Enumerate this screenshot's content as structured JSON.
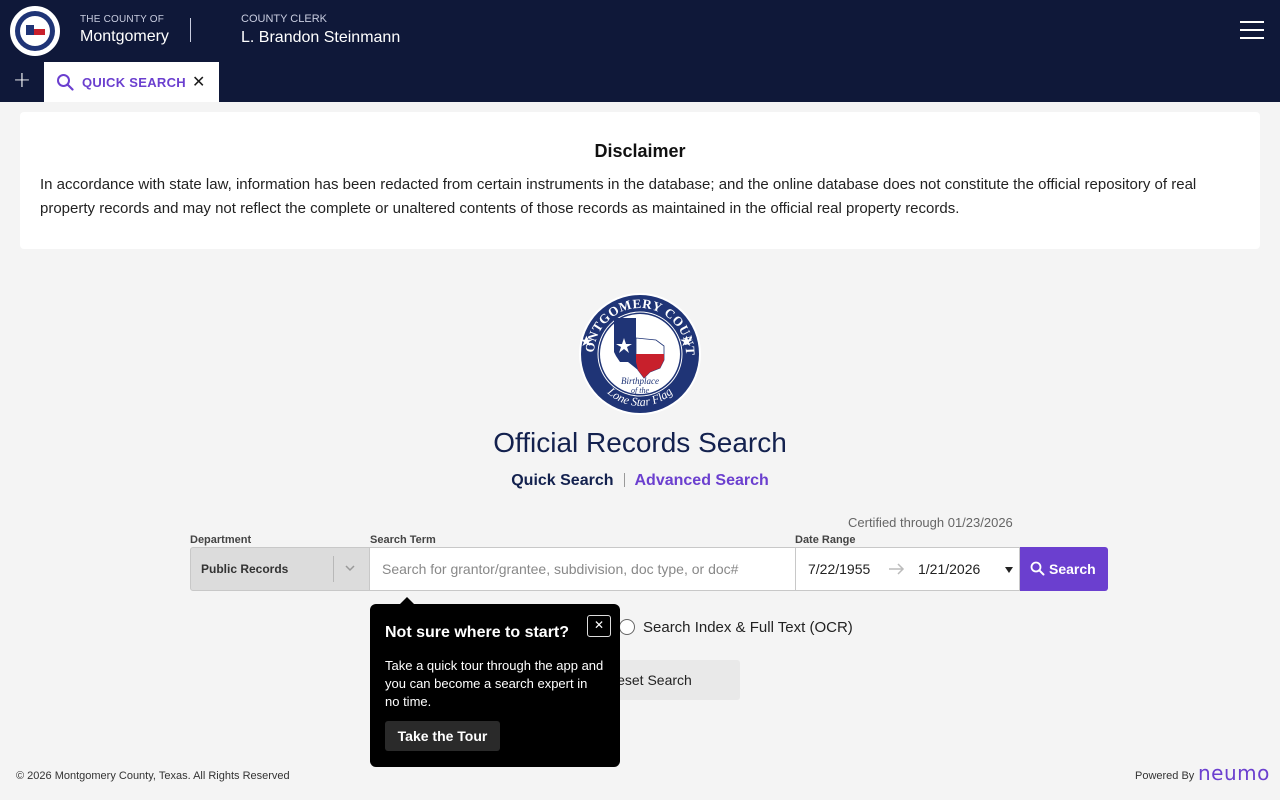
{
  "header": {
    "county_small": "THE COUNTY OF",
    "county_name": "Montgomery",
    "clerk_small": "COUNTY CLERK",
    "clerk_name": "L. Brandon Steinmann",
    "menu_icon": "hamburger-icon"
  },
  "tabs": {
    "add_icon": "plus-icon",
    "active": {
      "icon": "search-icon",
      "label": "QUICK SEARCH",
      "close_icon": "close-icon"
    }
  },
  "disclaimer": {
    "title": "Disclaimer",
    "text": "In accordance with state law, information has been redacted from certain instruments in the database; and the online database does not constitute the official repository of real property records and may not reflect the complete or unaltered contents of those records as maintained in the official real property records."
  },
  "seal": {
    "ring_text": "MONTGOMERY COUNTY",
    "inner_text_1": "Birthplace",
    "inner_text_2": "of the",
    "bottom_text": "Lone Star Flag"
  },
  "main": {
    "title": "Official Records Search",
    "quick_search_link": "Quick Search",
    "advanced_search_link": "Advanced Search",
    "certified": "Certified through 01/23/2026"
  },
  "form": {
    "department_label": "Department",
    "department_value": "Public Records",
    "search_term_label": "Search Term",
    "search_placeholder": "Search for grantor/grantee, subdivision, doc type, or doc#",
    "search_value": "",
    "date_range_label": "Date Range",
    "date_from": "7/22/1955",
    "date_to": "1/21/2026",
    "search_button": "Search",
    "ocr_option": "Search Index & Full Text (OCR)",
    "reset_button": "Reset Search"
  },
  "tour": {
    "title": "Not sure where to start?",
    "close": "✕",
    "body": "Take a quick tour through the app and you can become a search expert in no time.",
    "button": "Take the Tour"
  },
  "footer": {
    "copyright": "© 2026 Montgomery County, Texas. All Rights Reserved",
    "powered_by": "Powered By",
    "brand": "neumo"
  },
  "colors": {
    "navy": "#0f1839",
    "purple": "#6b3fcf",
    "seal_blue": "#1f3476",
    "flag_red": "#c8202c"
  }
}
